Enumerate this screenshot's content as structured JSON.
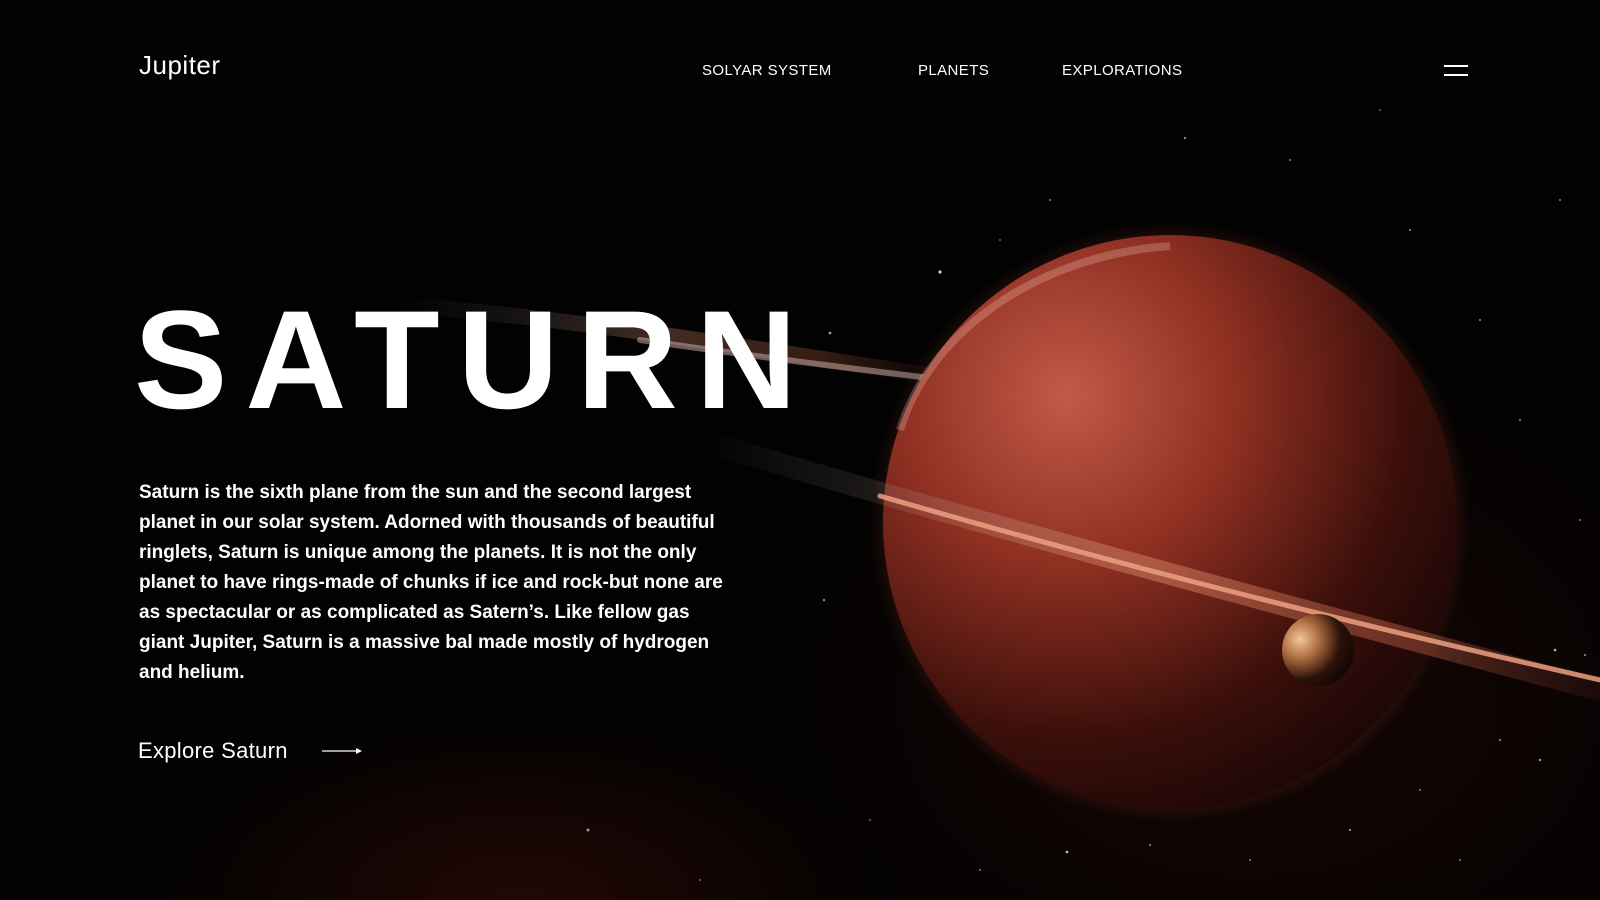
{
  "brand": {
    "name": "Jupiter"
  },
  "nav": {
    "items": [
      {
        "label": "SOLYAR SYSTEM"
      },
      {
        "label": "PLANETS"
      },
      {
        "label": "EXPLORATIONS"
      }
    ],
    "menu_icon": "hamburger-menu-icon"
  },
  "hero": {
    "title": "SATURN",
    "description": "Saturn is the sixth plane from the sun and the second largest planet in our solar system. Adorned with thousands of beautiful ringlets, Saturn is unique among the planets. It is not the only planet to have rings-made of chunks if ice and rock-but none are as spectacular or as complicated as Satern’s. Like fellow gas giant Jupiter, Saturn is a massive bal made mostly of hydrogen and helium.",
    "cta_label": "Explore Saturn",
    "cta_icon": "arrow-right-icon"
  },
  "colors": {
    "background": "#030202",
    "text": "#ffffff",
    "planet": "#8a2a1c",
    "ring": "#c97a5a"
  }
}
